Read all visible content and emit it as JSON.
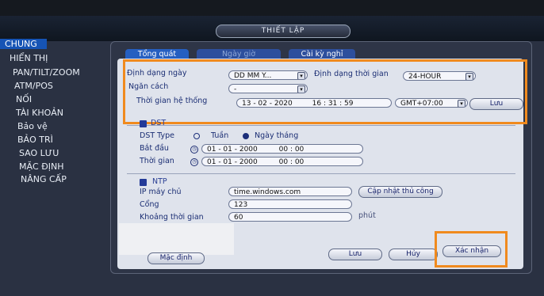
{
  "window": {
    "title": "THIẾT LẬP"
  },
  "sidebar": {
    "items": [
      {
        "label": "CHUNG"
      },
      {
        "label": "HIỂN THỊ"
      },
      {
        "label": "PAN/TILT/ZOOM"
      },
      {
        "label": "ATM/POS"
      },
      {
        "label": "NỐI"
      },
      {
        "label": "TÀI KHOẢN"
      },
      {
        "label": "Bảo vệ"
      },
      {
        "label": "BẢO TRÌ"
      },
      {
        "label": "SAO LƯU"
      },
      {
        "label": "MẶC ĐỊNH"
      },
      {
        "label": "NÂNG CẤP"
      }
    ]
  },
  "tabs": [
    {
      "label": "Tổng quát"
    },
    {
      "label": "Ngày giờ"
    },
    {
      "label": "Cài kỳ nghỉ"
    }
  ],
  "datetime": {
    "date_format_label": "Định dạng ngày",
    "date_format_value": "DD MM Y...",
    "time_format_label": "Định dạng thời gian",
    "time_format_value": "24-HOUR",
    "separator_label": "Ngăn cách",
    "separator_value": "-",
    "system_time_label": "Thời gian hệ thống",
    "system_date": "13 - 02 - 2020",
    "system_time": "16 : 31 : 59",
    "timezone": "GMT+07:00",
    "save_label": "Lưu"
  },
  "dst": {
    "checkbox_label": "DST",
    "type_label": "DST Type",
    "week_label": "Tuần",
    "date_label": "Ngày tháng",
    "start_label": "Bắt đầu",
    "start_date": "01 - 01 - 2000",
    "start_time": "00 : 00",
    "end_label": "Thời gian",
    "end_date": "01 - 01 - 2000",
    "end_time": "00 : 00"
  },
  "ntp": {
    "checkbox_label": "NTP",
    "server_label": "IP máy chủ",
    "server_value": "time.windows.com",
    "update_button": "Cập nhật thủ công",
    "port_label": "Cổng",
    "port_value": "123",
    "interval_label": "Khoảng thời gian",
    "interval_value": "60",
    "interval_unit": "phút"
  },
  "footer": {
    "default_button": "Mặc định",
    "save_button": "Lưu",
    "cancel_button": "Hủy",
    "confirm_button": "Xác nhận"
  },
  "colors": {
    "highlight": "#f08a1e",
    "accent": "#1654b5"
  }
}
